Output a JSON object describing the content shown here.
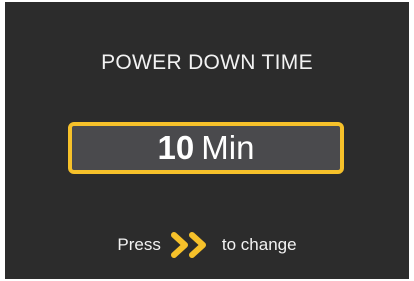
{
  "screen": {
    "title": "POWER DOWN TIME",
    "value": {
      "number": "10",
      "unit": "Min"
    },
    "hint": {
      "prefix": "Press",
      "icon": "double-chevron-right-icon",
      "suffix": "to change"
    }
  },
  "colors": {
    "background": "#2c2c2c",
    "accent": "#f6c12a",
    "value_box_fill": "#4a4a4d",
    "text": "#ffffff"
  }
}
